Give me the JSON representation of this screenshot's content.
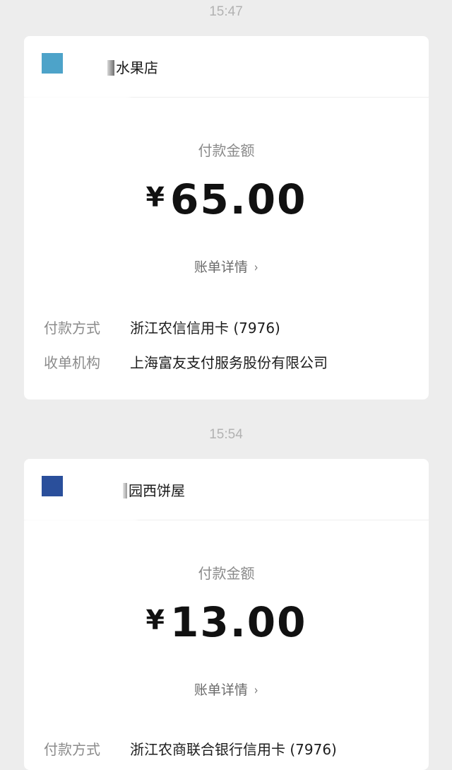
{
  "messages": [
    {
      "time": "15:47",
      "merchant": {
        "name": "水果店",
        "logo_color": "#4da3c9"
      },
      "amount_label": "付款金额",
      "currency_symbol": "¥",
      "amount": "65.00",
      "detail_link": "账单详情",
      "fields": [
        {
          "label": "付款方式",
          "value": "浙江农信信用卡 (7976)"
        },
        {
          "label": "收单机构",
          "value": "上海富友支付服务股份有限公司"
        }
      ]
    },
    {
      "time": "15:54",
      "merchant": {
        "name": "园西饼屋",
        "logo_color": "#2a4f9b"
      },
      "amount_label": "付款金额",
      "currency_symbol": "¥",
      "amount": "13.00",
      "detail_link": "账单详情",
      "fields": [
        {
          "label": "付款方式",
          "value": "浙江农商联合银行信用卡 (7976)"
        }
      ]
    }
  ],
  "colors": {
    "background": "#ededed",
    "card": "#ffffff",
    "primary_text": "#1c1c1c",
    "secondary_text": "#8b8b8b"
  },
  "icons": {
    "detail_chevron": "chevron-right-icon"
  }
}
